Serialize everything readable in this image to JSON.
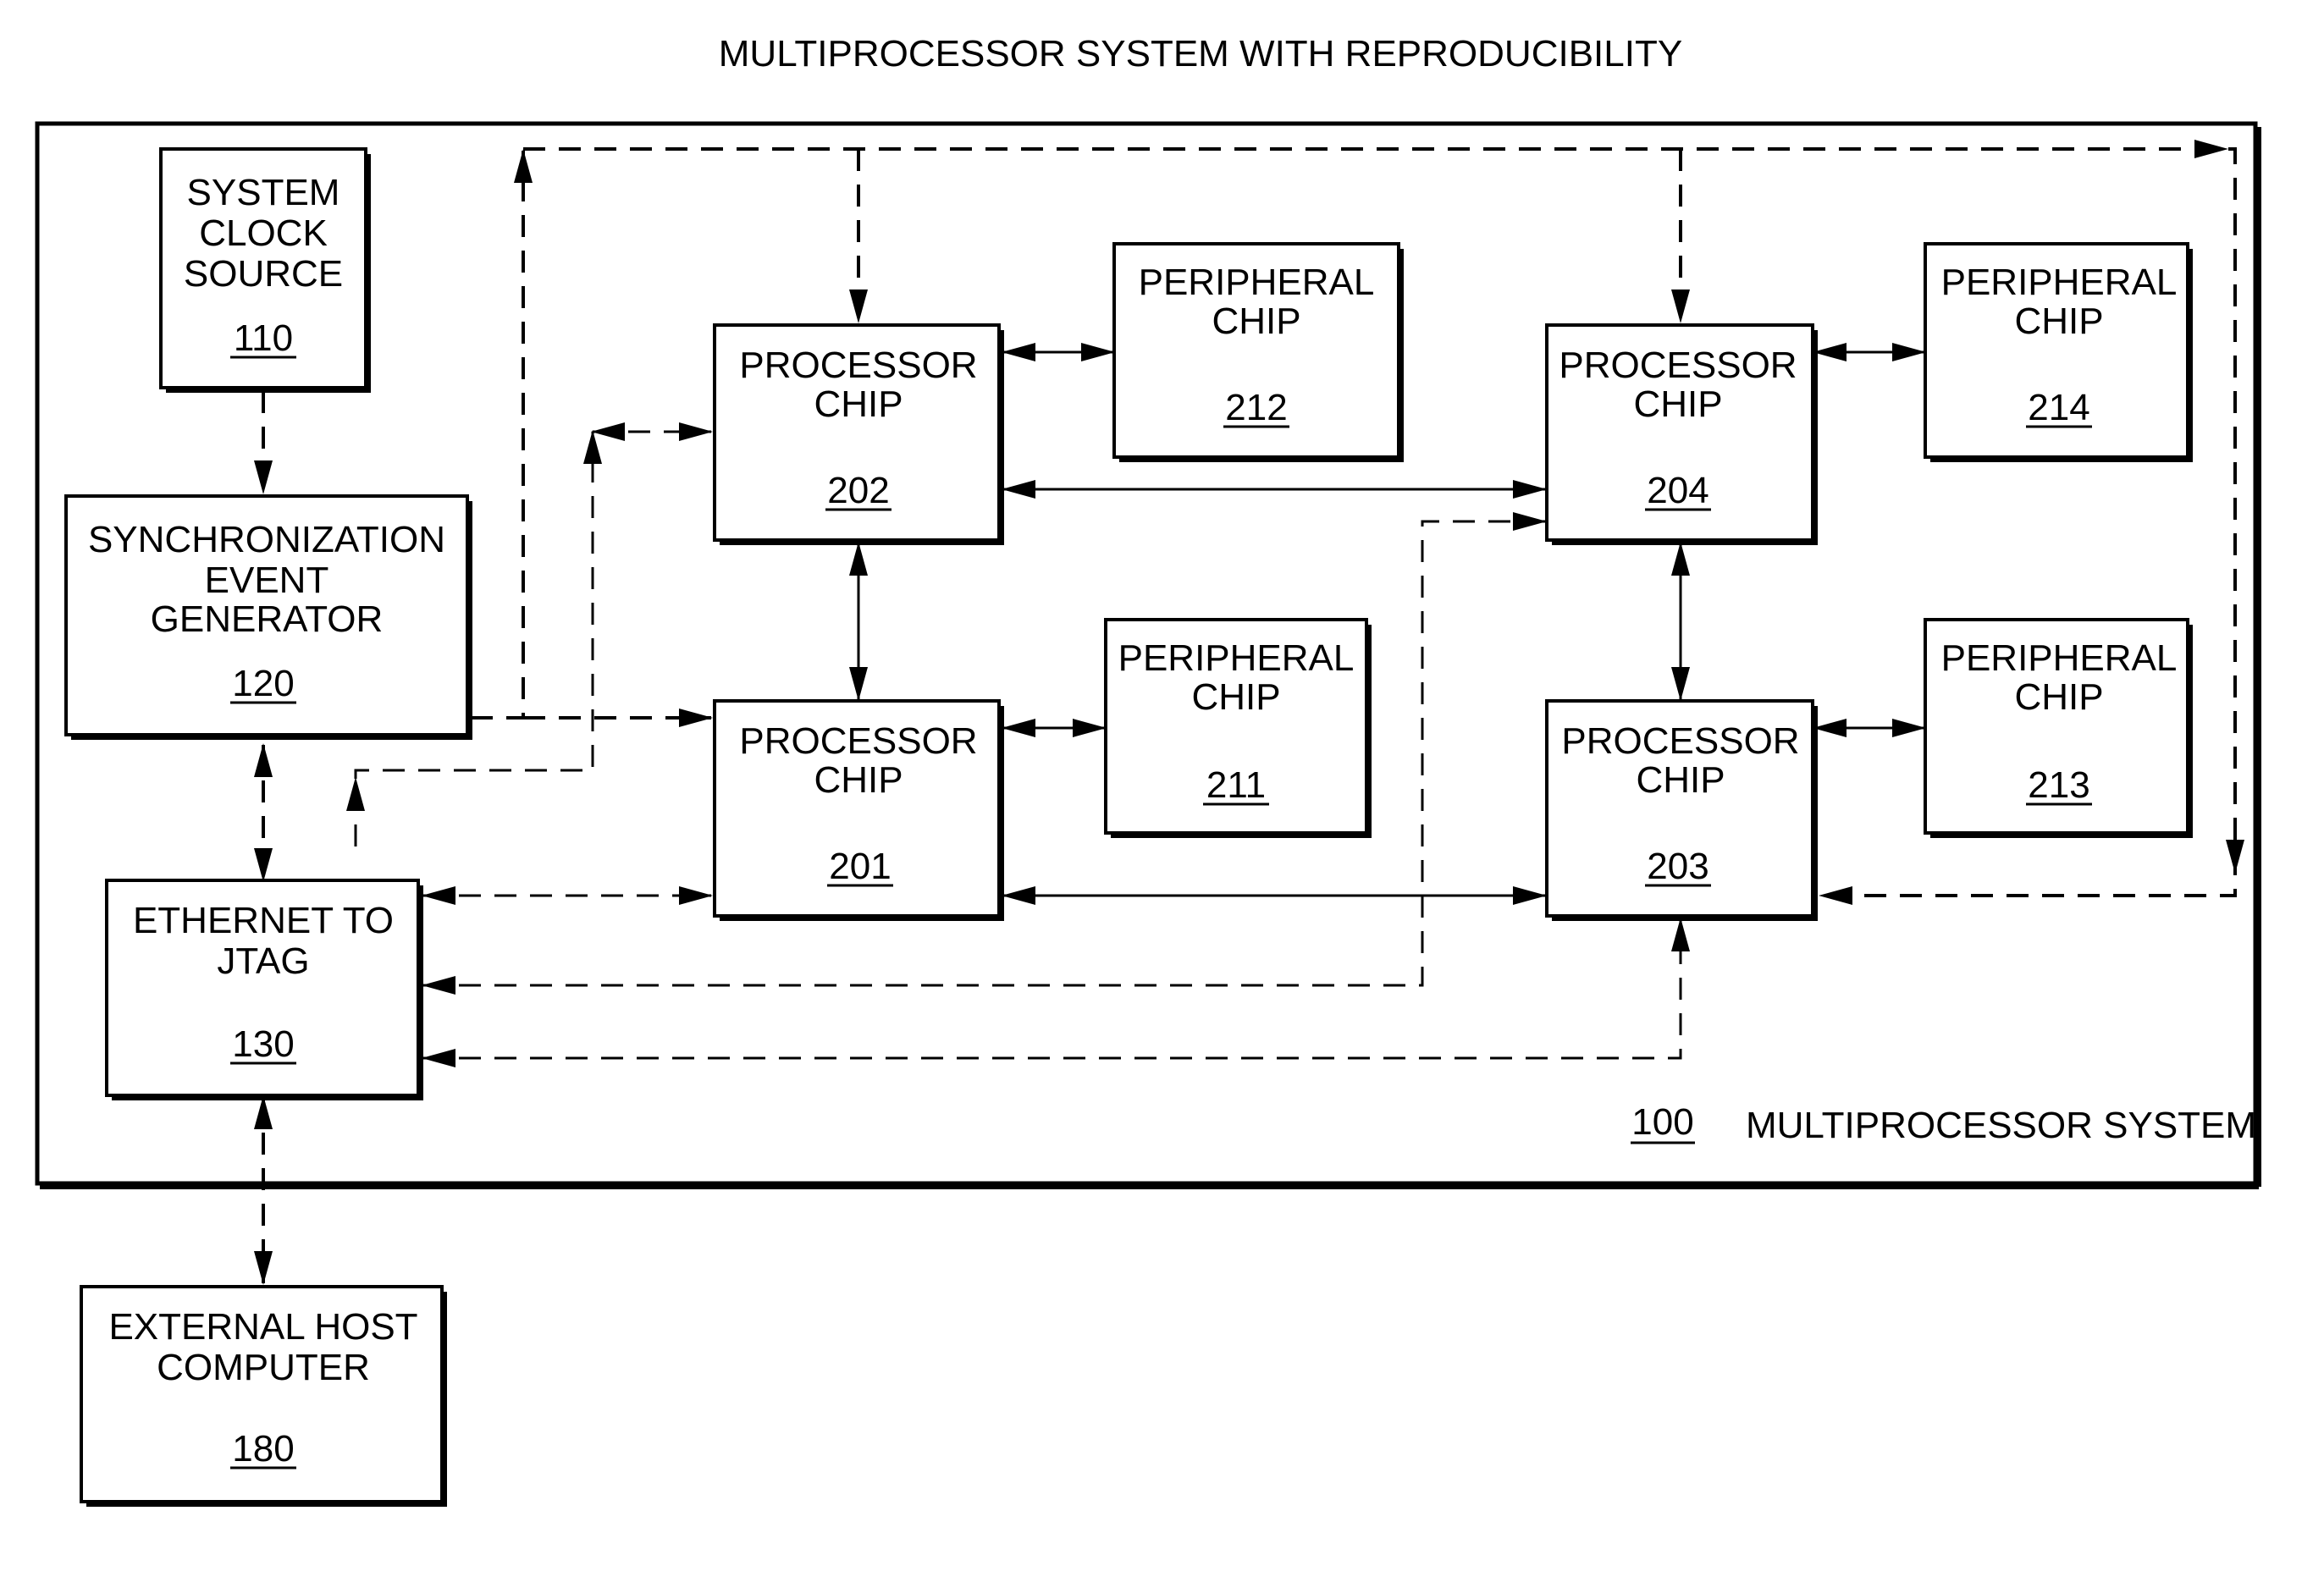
{
  "title": "MULTIPROCESSOR SYSTEM WITH REPRODUCIBILITY",
  "system": {
    "ref": "100",
    "label": "MULTIPROCESSOR SYSTEM"
  },
  "blocks": {
    "clock": {
      "lines": [
        "SYSTEM",
        "CLOCK",
        "SOURCE"
      ],
      "ref": "110"
    },
    "sync": {
      "lines": [
        "SYNCHRONIZATION",
        "EVENT",
        "GENERATOR"
      ],
      "ref": "120"
    },
    "jtag": {
      "lines": [
        "ETHERNET TO",
        "JTAG"
      ],
      "ref": "130"
    },
    "host": {
      "lines": [
        "EXTERNAL HOST",
        "COMPUTER"
      ],
      "ref": "180"
    },
    "p201": {
      "lines": [
        "PROCESSOR",
        "CHIP"
      ],
      "ref": "201"
    },
    "p202": {
      "lines": [
        "PROCESSOR",
        "CHIP"
      ],
      "ref": "202"
    },
    "p203": {
      "lines": [
        "PROCESSOR",
        "CHIP"
      ],
      "ref": "203"
    },
    "p204": {
      "lines": [
        "PROCESSOR",
        "CHIP"
      ],
      "ref": "204"
    },
    "c211": {
      "lines": [
        "PERIPHERAL",
        "CHIP"
      ],
      "ref": "211"
    },
    "c212": {
      "lines": [
        "PERIPHERAL",
        "CHIP"
      ],
      "ref": "212"
    },
    "c213": {
      "lines": [
        "PERIPHERAL",
        "CHIP"
      ],
      "ref": "213"
    },
    "c214": {
      "lines": [
        "PERIPHERAL",
        "CHIP"
      ],
      "ref": "214"
    }
  }
}
